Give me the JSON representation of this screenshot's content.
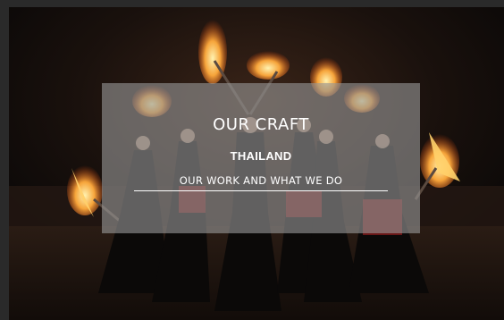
{
  "hero": {
    "image_alt": "Fire performers holding flaming torches on stage",
    "title": "OUR CRAFT",
    "location": "THAILAND",
    "subtitle": "OUR WORK AND WHAT WE DO"
  },
  "colors": {
    "background": "#120d0b",
    "overlay": "#969696",
    "text": "#ffffff",
    "flame": "#f6a43a"
  }
}
